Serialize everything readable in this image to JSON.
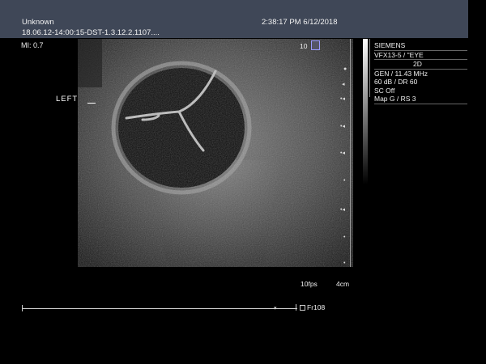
{
  "header": {
    "patient": "Unknown",
    "datetime": "2:38:17 PM 6/12/2018",
    "study_id": "18.06.12-14:00:15-DST-1.3.12.2.1107...."
  },
  "mi_label": "MI: 0.7",
  "side_label": "LEFT",
  "frame_index_top": "10",
  "settings": {
    "manufacturer": "SIEMENS",
    "transducer": "VFX13-5 / \"EYE",
    "mode": "2D",
    "frequency": "GEN / 11.43 MHz",
    "gain_dr": "60 dB / DR 60",
    "sc": "SC Off",
    "map": "Map G / RS 3"
  },
  "fps": "10fps",
  "depth": "4cm",
  "frame_label": "Fr108",
  "colors": {
    "header_bg": "#3f4757",
    "background": "#000000",
    "text": "#f2f2f2"
  }
}
